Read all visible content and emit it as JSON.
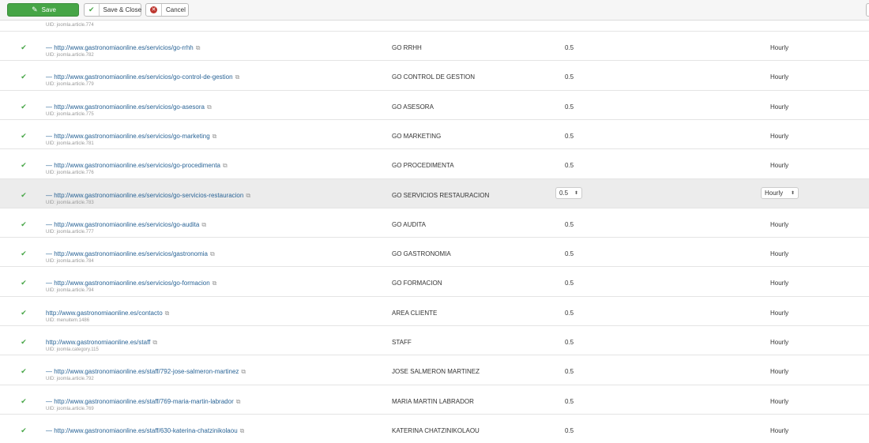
{
  "toolbar": {
    "save_label": "Save",
    "save_close_label": "Save & Close",
    "cancel_label": "Cancel",
    "save_icon": "edit-icon",
    "save_close_icon": "check-icon",
    "cancel_icon": "cancel-circle-icon"
  },
  "top_uid": "UID: joomla.article.774",
  "rows": [
    {
      "url": "— http://www.gastronomiaonline.es/servicios/go-rrhh",
      "uid": "UID: joomla.article.782",
      "title": "GO RRHH",
      "priority": "0.5",
      "frequency": "Hourly"
    },
    {
      "url": "— http://www.gastronomiaonline.es/servicios/go-control-de-gestion",
      "uid": "UID: joomla.article.779",
      "title": "GO CONTROL DE GESTION",
      "priority": "0.5",
      "frequency": "Hourly"
    },
    {
      "url": "— http://www.gastronomiaonline.es/servicios/go-asesora",
      "uid": "UID: joomla.article.775",
      "title": "GO ASESORA",
      "priority": "0.5",
      "frequency": "Hourly"
    },
    {
      "url": "— http://www.gastronomiaonline.es/servicios/go-marketing",
      "uid": "UID: joomla.article.781",
      "title": "GO MARKETING",
      "priority": "0.5",
      "frequency": "Hourly"
    },
    {
      "url": "— http://www.gastronomiaonline.es/servicios/go-procedimenta",
      "uid": "UID: joomla.article.776",
      "title": "GO PROCEDIMENTA",
      "priority": "0.5",
      "frequency": "Hourly"
    },
    {
      "url": "— http://www.gastronomiaonline.es/servicios/go-servicios-restauracion",
      "uid": "UID: joomla.article.783",
      "title": "GO SERVICIOS RESTAURACION",
      "priority": "0.5",
      "frequency": "Hourly",
      "active": true
    },
    {
      "url": "— http://www.gastronomiaonline.es/servicios/go-audita",
      "uid": "UID: joomla.article.777",
      "title": "GO AUDITA",
      "priority": "0.5",
      "frequency": "Hourly"
    },
    {
      "url": "— http://www.gastronomiaonline.es/servicios/gastronomia",
      "uid": "UID: joomla.article.784",
      "title": "GO GASTRONOMIA",
      "priority": "0.5",
      "frequency": "Hourly"
    },
    {
      "url": "— http://www.gastronomiaonline.es/servicios/go-formacion",
      "uid": "UID: joomla.article.794",
      "title": "GO FORMACION",
      "priority": "0.5",
      "frequency": "Hourly"
    },
    {
      "url": "http://www.gastronomiaonline.es/contacto",
      "uid": "UID: menuitem.1486",
      "title": "AREA CLIENTE",
      "priority": "0.5",
      "frequency": "Hourly"
    },
    {
      "url": "http://www.gastronomiaonline.es/staff",
      "uid": "UID: joomla.category.115",
      "title": "STAFF",
      "priority": "0.5",
      "frequency": "Hourly"
    },
    {
      "url": "— http://www.gastronomiaonline.es/staff/792-jose-salmeron-martinez",
      "uid": "UID: joomla.article.792",
      "title": "JOSE SALMERON MARTINEZ",
      "priority": "0.5",
      "frequency": "Hourly"
    },
    {
      "url": "— http://www.gastronomiaonline.es/staff/769-maria-martin-labrador",
      "uid": "UID: joomla.article.769",
      "title": "MARIA MARTIN LABRADOR",
      "priority": "0.5",
      "frequency": "Hourly"
    },
    {
      "url": "— http://www.gastronomiaonline.es/staff/630-katerina-chatzinikolaou",
      "uid": "",
      "title": "KATERINA CHATZINIKOLAOU",
      "priority": "0.5",
      "frequency": "Hourly"
    }
  ],
  "icons": {
    "status": "check-icon",
    "external_link": "external-link-icon",
    "select_arrow": "select-arrows-icon"
  },
  "colors": {
    "save_green": "#46a546",
    "link_blue": "#2a6496",
    "cancel_red": "#bd362f",
    "active_row": "#ececec"
  }
}
